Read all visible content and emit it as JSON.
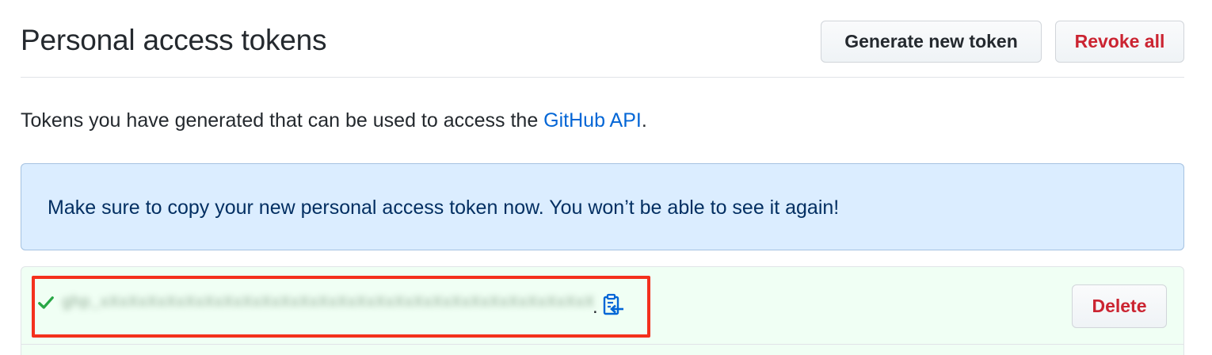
{
  "header": {
    "title": "Personal access tokens",
    "generate_label": "Generate new token",
    "revoke_label": "Revoke all"
  },
  "description": {
    "text_before": "Tokens you have generated that can be used to access the ",
    "link_text": "GitHub API",
    "text_after": "."
  },
  "flash": {
    "message": "Make sure to copy your new personal access token now. You won’t be able to see it again!"
  },
  "token": {
    "value_redacted": "ghp_xXxXxXxXxXxXxXxXxXxXxXxXxXxXxXxXxXxXxXxXxXxXxXxXxXxX",
    "delete_label": "Delete",
    "status_icon": "check-icon",
    "copy_icon": "clipboard-icon"
  },
  "colors": {
    "link": "#0366d6",
    "danger": "#cb2431",
    "flash_bg": "#dbedff",
    "flash_text": "#032f62",
    "token_bg": "#f0fff4",
    "success": "#28a745",
    "highlight": "#f4301d"
  }
}
